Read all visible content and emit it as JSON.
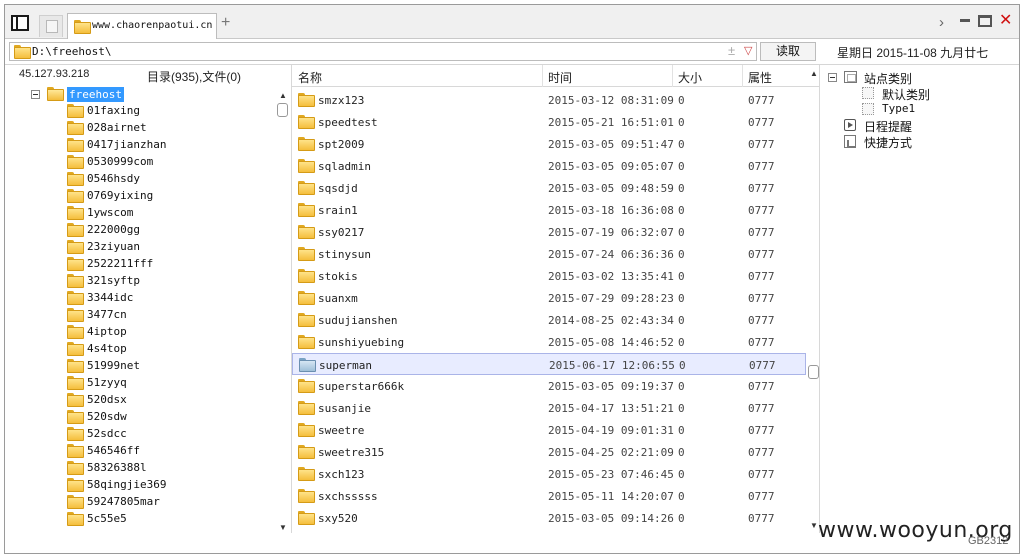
{
  "tabbar": {
    "tab_title": "www.chaorenpaotui.cn",
    "new_tab": "+",
    "chevron": "›",
    "close": "✕"
  },
  "address": {
    "path": "D:\\freehost\\",
    "pm": "±",
    "dropdown": "▽",
    "read_button": "读取",
    "date": "星期日 2015-11-08 九月廿七"
  },
  "left": {
    "ip": "45.127.93.218",
    "counts": "目录(935),文件(0)",
    "root": "freehost",
    "items": [
      "01faxing",
      "028airnet",
      "0417jianzhan",
      "0530999com",
      "0546hsdy",
      "0769yixing",
      "1ywscom",
      "222000gg",
      "23ziyuan",
      "2522211fff",
      "321syftp",
      "3344idc",
      "3477cn",
      "4iptop",
      "4s4top",
      "51999net",
      "51zyyq",
      "520dsx",
      "520sdw",
      "52sdcc",
      "546546ff",
      "58326388l",
      "58qingjie369",
      "59247805mar",
      "5c55e5"
    ],
    "scroll_up": "▲",
    "scroll_down": "▼"
  },
  "list": {
    "headers": {
      "name": "名称",
      "time": "时间",
      "size": "大小",
      "attr": "属性"
    },
    "rows": [
      {
        "name": "smzx123",
        "time": "2015-03-12 08:31:09",
        "size": "0",
        "attr": "0777"
      },
      {
        "name": "speedtest",
        "time": "2015-05-21 16:51:01",
        "size": "0",
        "attr": "0777"
      },
      {
        "name": "spt2009",
        "time": "2015-03-05 09:51:47",
        "size": "0",
        "attr": "0777"
      },
      {
        "name": "sqladmin",
        "time": "2015-03-05 09:05:07",
        "size": "0",
        "attr": "0777"
      },
      {
        "name": "sqsdjd",
        "time": "2015-03-05 09:48:59",
        "size": "0",
        "attr": "0777"
      },
      {
        "name": "srain1",
        "time": "2015-03-18 16:36:08",
        "size": "0",
        "attr": "0777"
      },
      {
        "name": "ssy0217",
        "time": "2015-07-19 06:32:07",
        "size": "0",
        "attr": "0777"
      },
      {
        "name": "stinysun",
        "time": "2015-07-24 06:36:36",
        "size": "0",
        "attr": "0777"
      },
      {
        "name": "stokis",
        "time": "2015-03-02 13:35:41",
        "size": "0",
        "attr": "0777"
      },
      {
        "name": "suanxm",
        "time": "2015-07-29 09:28:23",
        "size": "0",
        "attr": "0777"
      },
      {
        "name": "sudujianshen",
        "time": "2014-08-25 02:43:34",
        "size": "0",
        "attr": "0777"
      },
      {
        "name": "sunshiyuebing",
        "time": "2015-05-08 14:46:52",
        "size": "0",
        "attr": "0777"
      },
      {
        "name": "superman",
        "time": "2015-06-17 12:06:55",
        "size": "0",
        "attr": "0777",
        "selected": true
      },
      {
        "name": "superstar666k",
        "time": "2015-03-05 09:19:37",
        "size": "0",
        "attr": "0777"
      },
      {
        "name": "susanjie",
        "time": "2015-04-17 13:51:21",
        "size": "0",
        "attr": "0777"
      },
      {
        "name": "sweetre",
        "time": "2015-04-19 09:01:31",
        "size": "0",
        "attr": "0777"
      },
      {
        "name": "sweetre315",
        "time": "2015-04-25 02:21:09",
        "size": "0",
        "attr": "0777"
      },
      {
        "name": "sxch123",
        "time": "2015-05-23 07:46:45",
        "size": "0",
        "attr": "0777"
      },
      {
        "name": "sxchsssss",
        "time": "2015-05-11 14:20:07",
        "size": "0",
        "attr": "0777"
      },
      {
        "name": "sxy520",
        "time": "2015-03-05 09:14:26",
        "size": "0",
        "attr": "0777"
      }
    ],
    "scroll_up": "▲",
    "scroll_down": "▼"
  },
  "right": {
    "site_category": "站点类别",
    "default_category": "默认类别",
    "type1": "Type1",
    "schedule": "日程提醒",
    "shortcuts": "快捷方式"
  },
  "footer": {
    "watermark": "www.wooyun.org",
    "encoding": "GB2312"
  }
}
